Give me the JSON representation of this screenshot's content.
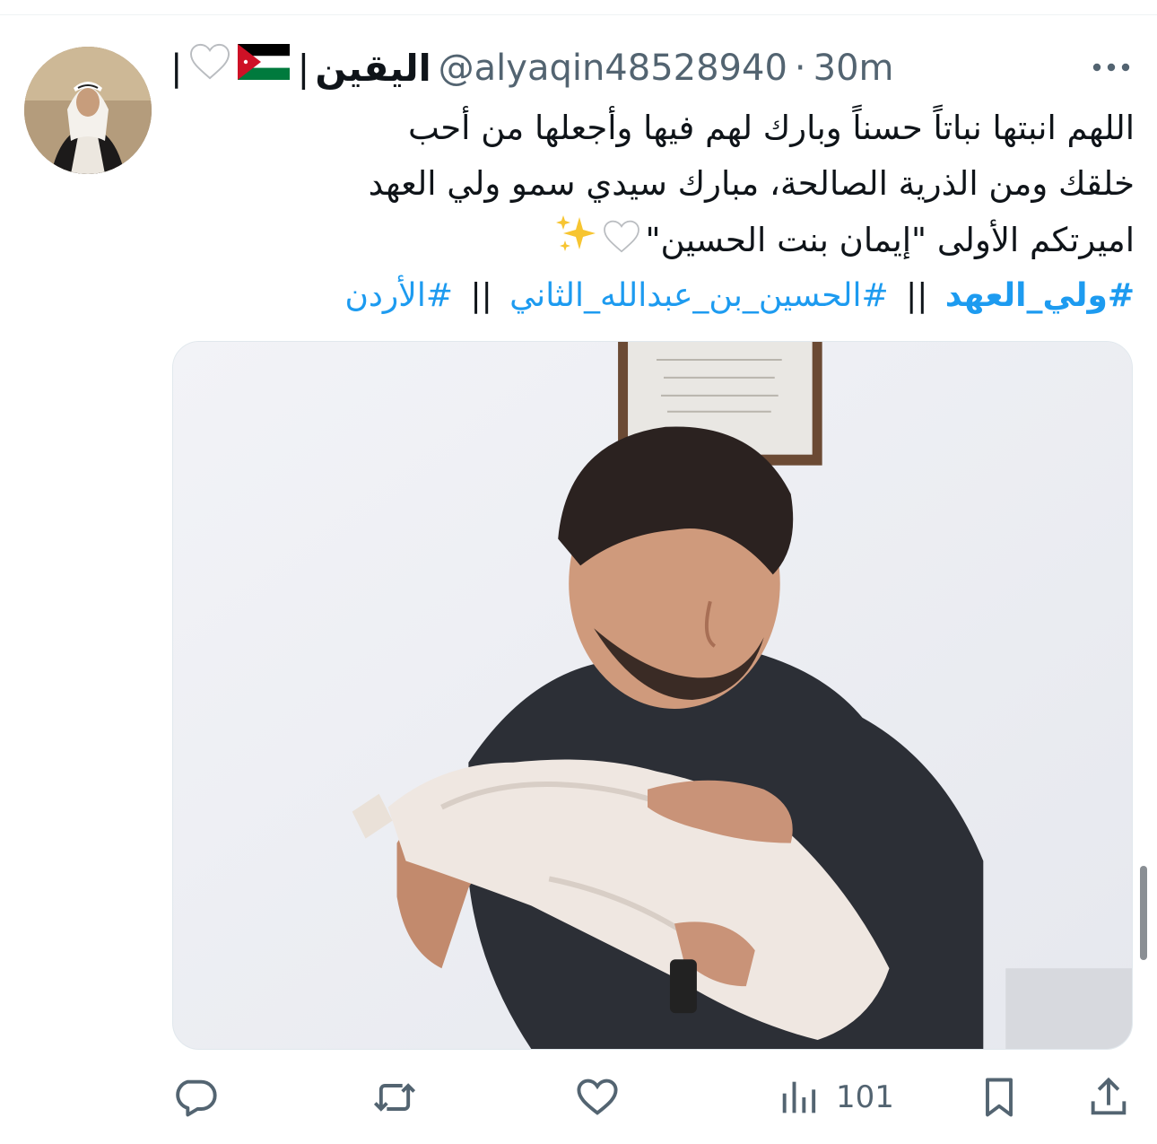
{
  "tweet": {
    "display_name": "اليقين",
    "name_suffix": "|",
    "name_prefix": "|",
    "handle": "@alyaqin48528940",
    "separator": "·",
    "timestamp": "30m",
    "text_lines": [
      "اللهم انبتها نباتاً حسناً وبارك لهم فيها وأجعلها من أحب",
      "خلقك ومن الذرية الصالحة، مبارك سيدي سمو ولي العهد",
      "اميرتكم الأولى \"إيمان بنت الحسين\""
    ],
    "hashtags": [
      {
        "text": "#ولي_العهد",
        "bold": true
      },
      {
        "text": "#الحسين_بن_عبدالله_الثاني",
        "bold": false
      },
      {
        "text": "#الأردن",
        "bold": false
      }
    ],
    "hashtag_separator": "||",
    "hashtag_separator_trailing": "||"
  },
  "icons": {
    "flag": "jordan-flag-icon",
    "heart": "white-heart-icon",
    "sparkles": "sparkles-icon",
    "more": "more-options-icon"
  },
  "actions": {
    "reply": {
      "icon": "reply-icon",
      "count": ""
    },
    "retweet": {
      "icon": "retweet-icon",
      "count": ""
    },
    "like": {
      "icon": "like-icon",
      "count": ""
    },
    "views": {
      "icon": "views-icon",
      "count": "101"
    },
    "bookmark": {
      "icon": "bookmark-icon",
      "count": ""
    },
    "share": {
      "icon": "share-icon",
      "count": ""
    }
  },
  "colors": {
    "link": "#1d9bf0",
    "secondary_text": "#536471",
    "primary_text": "#0f1419",
    "flag_black": "#000000",
    "flag_green": "#007a3d",
    "flag_red": "#ce1126"
  }
}
